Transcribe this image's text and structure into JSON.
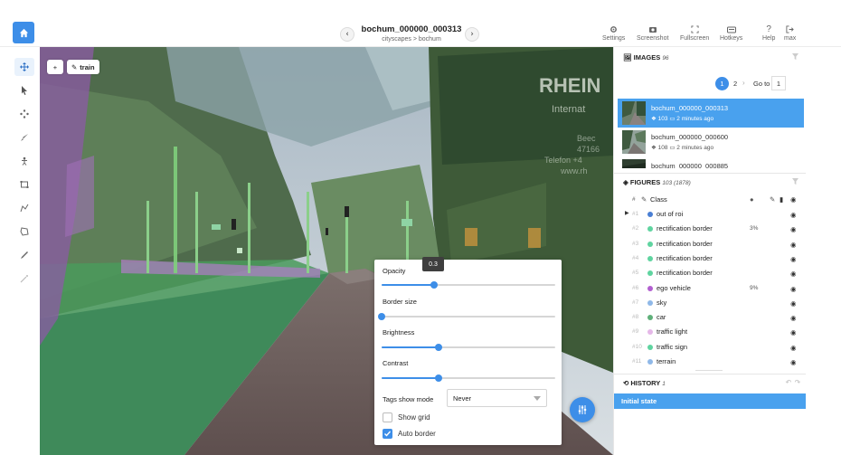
{
  "colors": {
    "accent": "#3d8ee8",
    "selected_row": "#49a1ee"
  },
  "header": {
    "title": "bochum_000000_000313",
    "breadcrumb": "cityscapes > bochum",
    "tools": [
      {
        "label": "Settings",
        "icon": "gear-icon"
      },
      {
        "label": "Screenshot",
        "icon": "camera-icon"
      },
      {
        "label": "Fullscreen",
        "icon": "fullscreen-icon"
      },
      {
        "label": "Hotkeys",
        "icon": "keyboard-icon"
      },
      {
        "label": "Help",
        "icon": "question-icon"
      },
      {
        "label": "max",
        "icon": "logout-icon"
      }
    ]
  },
  "canvas": {
    "tag_label": "train",
    "add_label": "+"
  },
  "popup": {
    "opacity_label": "Opacity",
    "opacity_value": "0.3",
    "opacity_fraction": 0.3,
    "border_label": "Border size",
    "border_fraction": 0.0,
    "brightness_label": "Brightness",
    "brightness_fraction": 0.33,
    "contrast_label": "Contrast",
    "contrast_fraction": 0.33,
    "tags_mode_label": "Tags show mode",
    "tags_mode_value": "Never",
    "show_grid_label": "Show grid",
    "show_grid_checked": false,
    "auto_border_label": "Auto border",
    "auto_border_checked": true
  },
  "images": {
    "title": "IMAGES",
    "count": "96",
    "pages": [
      "1",
      "2"
    ],
    "goto_label": "Go to",
    "goto_value": "1",
    "items": [
      {
        "name": "bochum_000000_000313",
        "meta_count": "103",
        "meta_time": "2 minutes ago"
      },
      {
        "name": "bochum_000000_000600",
        "meta_count": "108",
        "meta_time": "2 minutes ago"
      },
      {
        "name": "bochum_000000_000885",
        "meta_count": "",
        "meta_time": ""
      }
    ]
  },
  "figures": {
    "title": "FIGURES",
    "count": "103 (1878)",
    "col_num": "#",
    "col_class": "Class",
    "rows": [
      {
        "num": "#1",
        "name": "out of roi",
        "color": "#4a7fd4",
        "pct": ""
      },
      {
        "num": "#2",
        "name": "rectification border",
        "color": "#5fd4a0",
        "pct": "3%"
      },
      {
        "num": "#3",
        "name": "rectification border",
        "color": "#5fd4a0",
        "pct": ""
      },
      {
        "num": "#4",
        "name": "rectification border",
        "color": "#5fd4a0",
        "pct": ""
      },
      {
        "num": "#5",
        "name": "rectification border",
        "color": "#5fd4a0",
        "pct": ""
      },
      {
        "num": "#6",
        "name": "ego vehicle",
        "color": "#b25fd0",
        "pct": "9%"
      },
      {
        "num": "#7",
        "name": "sky",
        "color": "#8fb8e8",
        "pct": ""
      },
      {
        "num": "#8",
        "name": "car",
        "color": "#5fb07a",
        "pct": ""
      },
      {
        "num": "#9",
        "name": "traffic light",
        "color": "#e5b8e8",
        "pct": ""
      },
      {
        "num": "#10",
        "name": "traffic sign",
        "color": "#5fd4a0",
        "pct": ""
      },
      {
        "num": "#11",
        "name": "terrain",
        "color": "#8fb8e8",
        "pct": ""
      }
    ]
  },
  "history": {
    "title": "HISTORY",
    "count": "1",
    "items": [
      "Initial state"
    ]
  }
}
